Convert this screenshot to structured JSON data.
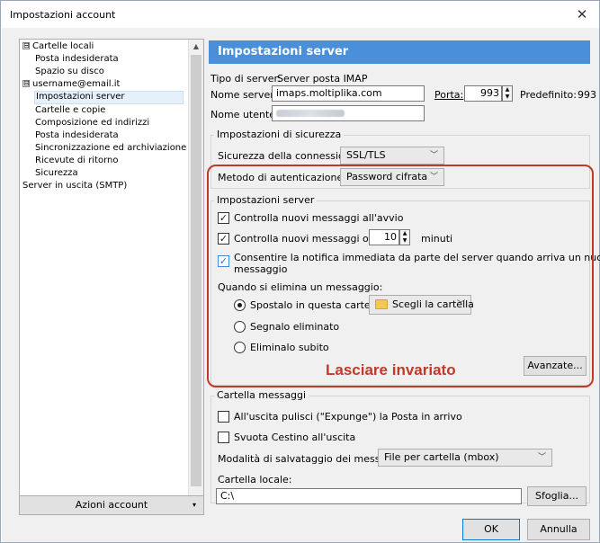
{
  "window": {
    "title": "Impostazioni account",
    "close": "✕"
  },
  "tree": {
    "items": [
      {
        "label": "Cartelle locali",
        "expander": "⊟"
      },
      {
        "label": "Posta indesiderata"
      },
      {
        "label": "Spazio su disco"
      },
      {
        "label": "username@email.it",
        "expander": "⊟"
      },
      {
        "label": "Impostazioni server"
      },
      {
        "label": "Cartelle e copie"
      },
      {
        "label": "Composizione ed indirizzi"
      },
      {
        "label": "Posta indesiderata"
      },
      {
        "label": "Sincronizzazione ed archiviazione"
      },
      {
        "label": "Ricevute di ritorno"
      },
      {
        "label": "Sicurezza"
      },
      {
        "label": "Server in uscita (SMTP)"
      }
    ]
  },
  "account_actions": {
    "label": "Azioni account",
    "caret": "▾"
  },
  "panel": {
    "header": "Impostazioni server",
    "server_type_label": "Tipo di server:",
    "server_type_value": "Server posta IMAP",
    "server_name_label": "Nome server:",
    "server_name_value": "imaps.moltiplika.com",
    "port_label": "Porta:",
    "port_value": "993",
    "default_label": "Predefinito:",
    "default_value": "993",
    "username_label": "Nome utente:",
    "security_group": "Impostazioni di sicurezza",
    "conn_security_label": "Sicurezza della connessione:",
    "conn_security_value": "SSL/TLS",
    "auth_label": "Metodo di autenticazione:",
    "auth_value": "Password cifrata",
    "server_group": "Impostazioni server",
    "check_startup": "Controlla nuovi messaggi all'avvio",
    "check_every": "Controlla nuovi messaggi ogni",
    "check_every_value": "10",
    "minutes": "minuti",
    "idle_line1": "Consentire la notifica immediata da parte del server quando arriva un nuovo",
    "idle_line2": "messaggio",
    "delete_label": "Quando si elimina un messaggio:",
    "move_label": "Spostalo in questa cartella:",
    "folder_select": "Scegli la cartella",
    "mark_deleted": "Segnalo eliminato",
    "delete_now": "Eliminalo subito",
    "advanced": "Avanzate...",
    "note": "Lasciare invariato",
    "storage_group": "Cartella messaggi",
    "expunge": "All'uscita pulisci (\"Expunge\") la Posta in arrivo",
    "empty_trash": "Svuota Cestino all'uscita",
    "storage_type_label": "Modalità di salvataggio dei messaggi:",
    "storage_type_value": "File per cartella (mbox)",
    "local_dir_label": "Cartella locale:",
    "local_dir_value": "C:\\",
    "browse": "Sfoglia..."
  },
  "footer": {
    "ok": "OK",
    "cancel": "Annulla"
  },
  "colors": {
    "header_bg": "#4a8fd9",
    "highlight": "#c0392b"
  }
}
